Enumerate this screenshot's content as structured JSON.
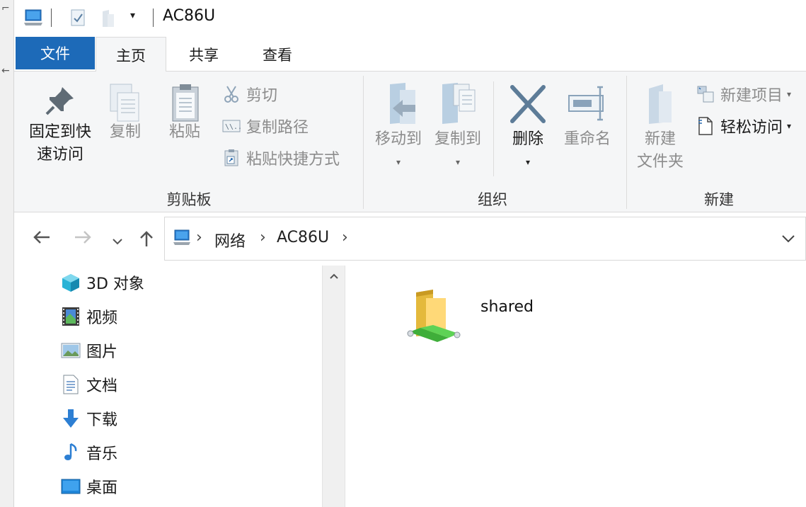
{
  "window": {
    "title": "AC86U"
  },
  "tabs": {
    "file": "文件",
    "home": "主页",
    "share": "共享",
    "view": "查看"
  },
  "ribbon": {
    "clipboard": {
      "label": "剪贴板",
      "pin_line1": "固定到快",
      "pin_line2": "速访问",
      "copy": "复制",
      "paste": "粘贴",
      "cut": "剪切",
      "copy_path": "复制路径",
      "paste_shortcut": "粘贴快捷方式"
    },
    "organize": {
      "label": "组织",
      "move_to": "移动到",
      "copy_to": "复制到",
      "delete": "删除",
      "rename": "重命名"
    },
    "new": {
      "label": "新建",
      "new_folder_line1": "新建",
      "new_folder_line2": "文件夹",
      "new_item": "新建项目",
      "easy_access": "轻松访问"
    }
  },
  "address": {
    "crumbs": [
      "网络",
      "AC86U"
    ]
  },
  "nav_pane": {
    "items": [
      {
        "label": "3D 对象",
        "icon": "3d-objects-icon"
      },
      {
        "label": "视频",
        "icon": "videos-icon"
      },
      {
        "label": "图片",
        "icon": "pictures-icon"
      },
      {
        "label": "文档",
        "icon": "documents-icon"
      },
      {
        "label": "下载",
        "icon": "downloads-icon"
      },
      {
        "label": "音乐",
        "icon": "music-icon"
      },
      {
        "label": "桌面",
        "icon": "desktop-icon"
      }
    ]
  },
  "content": {
    "items": [
      {
        "name": "shared",
        "icon": "network-share-folder-icon"
      }
    ]
  },
  "colors": {
    "accent": "#1d6ab8",
    "disabled_text": "#8c8c8c",
    "ribbon_bg": "#f5f6f7"
  }
}
